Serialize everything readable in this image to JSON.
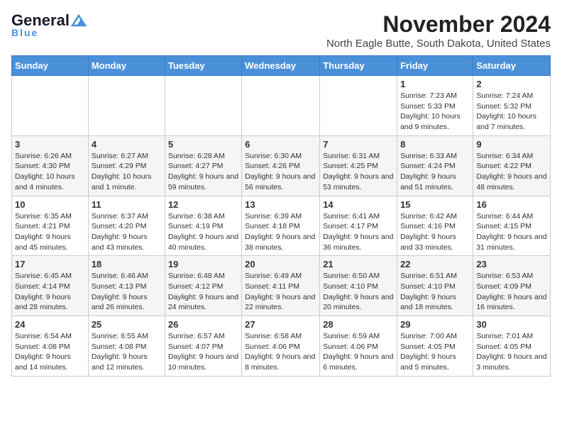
{
  "logo": {
    "line1": "General",
    "line2": "Blue"
  },
  "title": "November 2024",
  "location": "North Eagle Butte, South Dakota, United States",
  "weekdays": [
    "Sunday",
    "Monday",
    "Tuesday",
    "Wednesday",
    "Thursday",
    "Friday",
    "Saturday"
  ],
  "weeks": [
    [
      null,
      null,
      null,
      null,
      null,
      {
        "day": "1",
        "sunrise": "7:23 AM",
        "sunset": "5:33 PM",
        "daylight": "10 hours and 9 minutes."
      },
      {
        "day": "2",
        "sunrise": "7:24 AM",
        "sunset": "5:32 PM",
        "daylight": "10 hours and 7 minutes."
      }
    ],
    [
      {
        "day": "3",
        "sunrise": "6:26 AM",
        "sunset": "4:30 PM",
        "daylight": "10 hours and 4 minutes."
      },
      {
        "day": "4",
        "sunrise": "6:27 AM",
        "sunset": "4:29 PM",
        "daylight": "10 hours and 1 minute."
      },
      {
        "day": "5",
        "sunrise": "6:28 AM",
        "sunset": "4:27 PM",
        "daylight": "9 hours and 59 minutes."
      },
      {
        "day": "6",
        "sunrise": "6:30 AM",
        "sunset": "4:26 PM",
        "daylight": "9 hours and 56 minutes."
      },
      {
        "day": "7",
        "sunrise": "6:31 AM",
        "sunset": "4:25 PM",
        "daylight": "9 hours and 53 minutes."
      },
      {
        "day": "8",
        "sunrise": "6:33 AM",
        "sunset": "4:24 PM",
        "daylight": "9 hours and 51 minutes."
      },
      {
        "day": "9",
        "sunrise": "6:34 AM",
        "sunset": "4:22 PM",
        "daylight": "9 hours and 48 minutes."
      }
    ],
    [
      {
        "day": "10",
        "sunrise": "6:35 AM",
        "sunset": "4:21 PM",
        "daylight": "9 hours and 45 minutes."
      },
      {
        "day": "11",
        "sunrise": "6:37 AM",
        "sunset": "4:20 PM",
        "daylight": "9 hours and 43 minutes."
      },
      {
        "day": "12",
        "sunrise": "6:38 AM",
        "sunset": "4:19 PM",
        "daylight": "9 hours and 40 minutes."
      },
      {
        "day": "13",
        "sunrise": "6:39 AM",
        "sunset": "4:18 PM",
        "daylight": "9 hours and 38 minutes."
      },
      {
        "day": "14",
        "sunrise": "6:41 AM",
        "sunset": "4:17 PM",
        "daylight": "9 hours and 36 minutes."
      },
      {
        "day": "15",
        "sunrise": "6:42 AM",
        "sunset": "4:16 PM",
        "daylight": "9 hours and 33 minutes."
      },
      {
        "day": "16",
        "sunrise": "6:44 AM",
        "sunset": "4:15 PM",
        "daylight": "9 hours and 31 minutes."
      }
    ],
    [
      {
        "day": "17",
        "sunrise": "6:45 AM",
        "sunset": "4:14 PM",
        "daylight": "9 hours and 28 minutes."
      },
      {
        "day": "18",
        "sunrise": "6:46 AM",
        "sunset": "4:13 PM",
        "daylight": "9 hours and 26 minutes."
      },
      {
        "day": "19",
        "sunrise": "6:48 AM",
        "sunset": "4:12 PM",
        "daylight": "9 hours and 24 minutes."
      },
      {
        "day": "20",
        "sunrise": "6:49 AM",
        "sunset": "4:11 PM",
        "daylight": "9 hours and 22 minutes."
      },
      {
        "day": "21",
        "sunrise": "6:50 AM",
        "sunset": "4:10 PM",
        "daylight": "9 hours and 20 minutes."
      },
      {
        "day": "22",
        "sunrise": "6:51 AM",
        "sunset": "4:10 PM",
        "daylight": "9 hours and 18 minutes."
      },
      {
        "day": "23",
        "sunrise": "6:53 AM",
        "sunset": "4:09 PM",
        "daylight": "9 hours and 16 minutes."
      }
    ],
    [
      {
        "day": "24",
        "sunrise": "6:54 AM",
        "sunset": "4:08 PM",
        "daylight": "9 hours and 14 minutes."
      },
      {
        "day": "25",
        "sunrise": "6:55 AM",
        "sunset": "4:08 PM",
        "daylight": "9 hours and 12 minutes."
      },
      {
        "day": "26",
        "sunrise": "6:57 AM",
        "sunset": "4:07 PM",
        "daylight": "9 hours and 10 minutes."
      },
      {
        "day": "27",
        "sunrise": "6:58 AM",
        "sunset": "4:06 PM",
        "daylight": "9 hours and 8 minutes."
      },
      {
        "day": "28",
        "sunrise": "6:59 AM",
        "sunset": "4:06 PM",
        "daylight": "9 hours and 6 minutes."
      },
      {
        "day": "29",
        "sunrise": "7:00 AM",
        "sunset": "4:05 PM",
        "daylight": "9 hours and 5 minutes."
      },
      {
        "day": "30",
        "sunrise": "7:01 AM",
        "sunset": "4:05 PM",
        "daylight": "9 hours and 3 minutes."
      }
    ]
  ]
}
